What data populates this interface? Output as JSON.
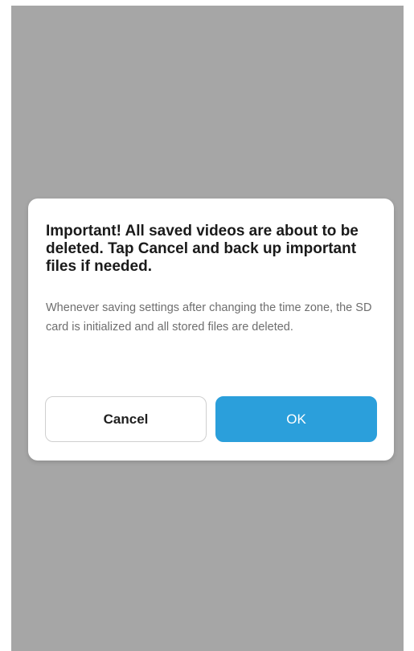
{
  "screen": {
    "overlay_color": "#a6a6a6"
  },
  "dialog": {
    "title": "Important!  All saved videos are about to be deleted. Tap Cancel and back up important files if needed.",
    "message": "Whenever saving settings after changing the time zone, the SD card is initialized and all stored files are deleted.",
    "cancel_label": "Cancel",
    "ok_label": "OK",
    "accent_color": "#2b9fdb"
  }
}
